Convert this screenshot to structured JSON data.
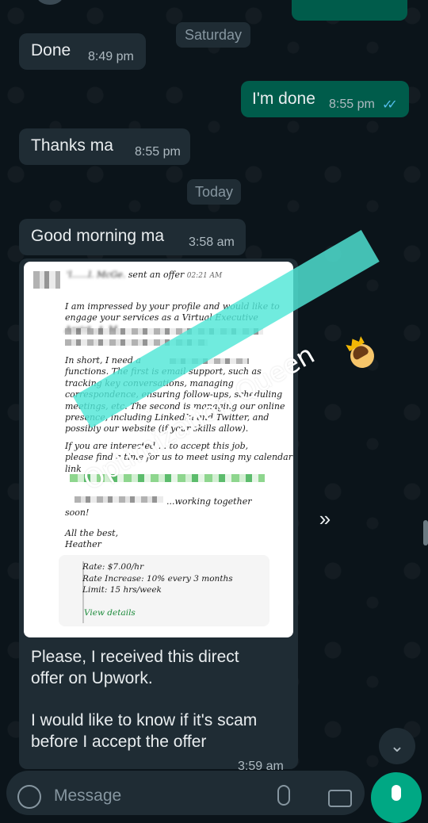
{
  "colors": {
    "background": "#0b141a",
    "incoming_bubble": "#1f2c34",
    "outgoing_bubble": "#005c4b",
    "read_ticks": "#53bdeb",
    "mic_button": "#00a884",
    "watermark": "#50e6d7"
  },
  "day_separators": [
    "Saturday",
    "Today"
  ],
  "messages": [
    {
      "direction": "in",
      "text": "Done",
      "time": "8:49 pm"
    },
    {
      "direction": "out",
      "text": "I'm done",
      "time": "8:55 pm",
      "status": "read-ticks-icon"
    },
    {
      "direction": "in",
      "text": "Thanks ma",
      "time": "8:55 pm"
    },
    {
      "direction": "in",
      "text": "Good morning ma",
      "time": "3:58 am"
    }
  ],
  "image_message": {
    "offer": {
      "header_sender": "'l......l. McGe.",
      "header_action": "sent an offer",
      "header_time": "02:21 AM",
      "p1_l1": "I am impressed by your profile and would like to",
      "p1_l2": "engage your services as a Virtual Executive",
      "p1_l3": "Assist...t. M",
      "p2_l1": "In short, I need a",
      "p2_l2": "functions. The first is email support, such as",
      "p2_l3": "tracking key conversations, managing",
      "p2_l4": "correspondence, ensuring follow-ups, scheduling",
      "p2_l5": "meetings, etc. The second is managing our online",
      "p2_l6": "presence, including LinkedIn and Twitter, and",
      "p2_l7": "possibly our website (if your skills allow).",
      "p3_l1": "If you are interested ... to accept this job,",
      "p3_l2": "please find a time for us to meet using my calendar",
      "p3_l3": "link",
      "p4_l1": "...working together",
      "p4_l2": "soon!",
      "signoff_l1": "All the best,",
      "signoff_l2": "Heather",
      "rate": "Rate: $7.00/hr",
      "rate_increase": "Rate Increase: 10% every 3 months",
      "limit": "Limit: 15 hrs/week",
      "view_details": "View details"
    },
    "watermark": "Optimization Queen",
    "caption_l1": "Please, I received this direct",
    "caption_l2": "offer on Upwork.",
    "caption_l3": "I would like to know if it's scam",
    "caption_l4": "before I accept the offer",
    "time": "3:59 am"
  },
  "input": {
    "placeholder": "Message",
    "icons": [
      "emoji-icon",
      "attach-icon",
      "camera-icon",
      "mic-icon"
    ]
  },
  "scroll_down_icon": "double-chevron-down-icon",
  "forward_icon": "forward-icon"
}
